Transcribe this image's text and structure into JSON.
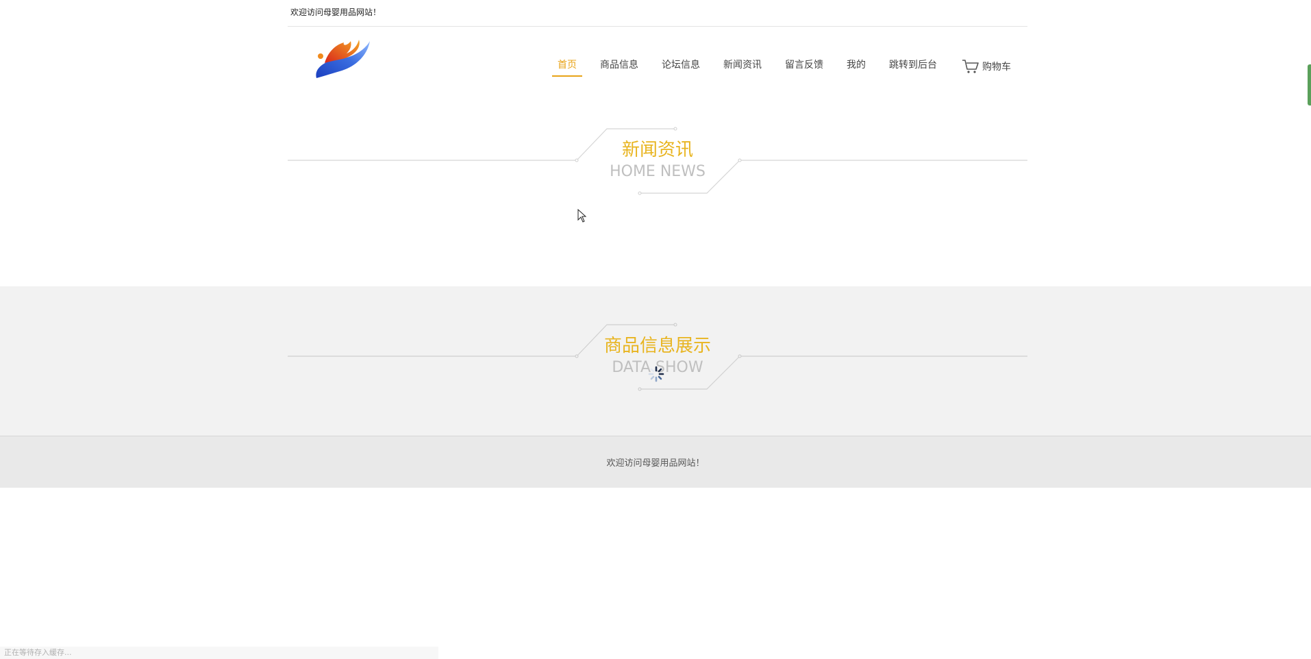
{
  "topbar": {
    "welcome": "欢迎访问母婴用品网站！"
  },
  "header": {
    "logo_icon": "phoenix-logo-icon",
    "nav": [
      {
        "label": "首页",
        "active": true
      },
      {
        "label": "商品信息"
      },
      {
        "label": "论坛信息"
      },
      {
        "label": "新闻资讯"
      },
      {
        "label": "留言反馈"
      },
      {
        "label": "我的"
      },
      {
        "label": "跳转到后台"
      }
    ],
    "cart": {
      "label": "购物车",
      "icon": "shopping-cart-icon"
    }
  },
  "news_section": {
    "title_zh": "新闻资讯",
    "title_en": "HOME NEWS"
  },
  "products_section": {
    "title_zh": "商品信息展示",
    "title_en": "DATA SHOW",
    "loading_icon": "loading-spinner-icon"
  },
  "footer": {
    "text": "欢迎访问母婴用品网站！"
  },
  "statusbar": {
    "text": "正在等待存入缓存..."
  },
  "colors": {
    "accent": "#e8a317",
    "title_zh": "#e8b41f",
    "title_en": "#bfbfbf",
    "band": "#f2f2f2",
    "footer": "#e9e9e9"
  }
}
